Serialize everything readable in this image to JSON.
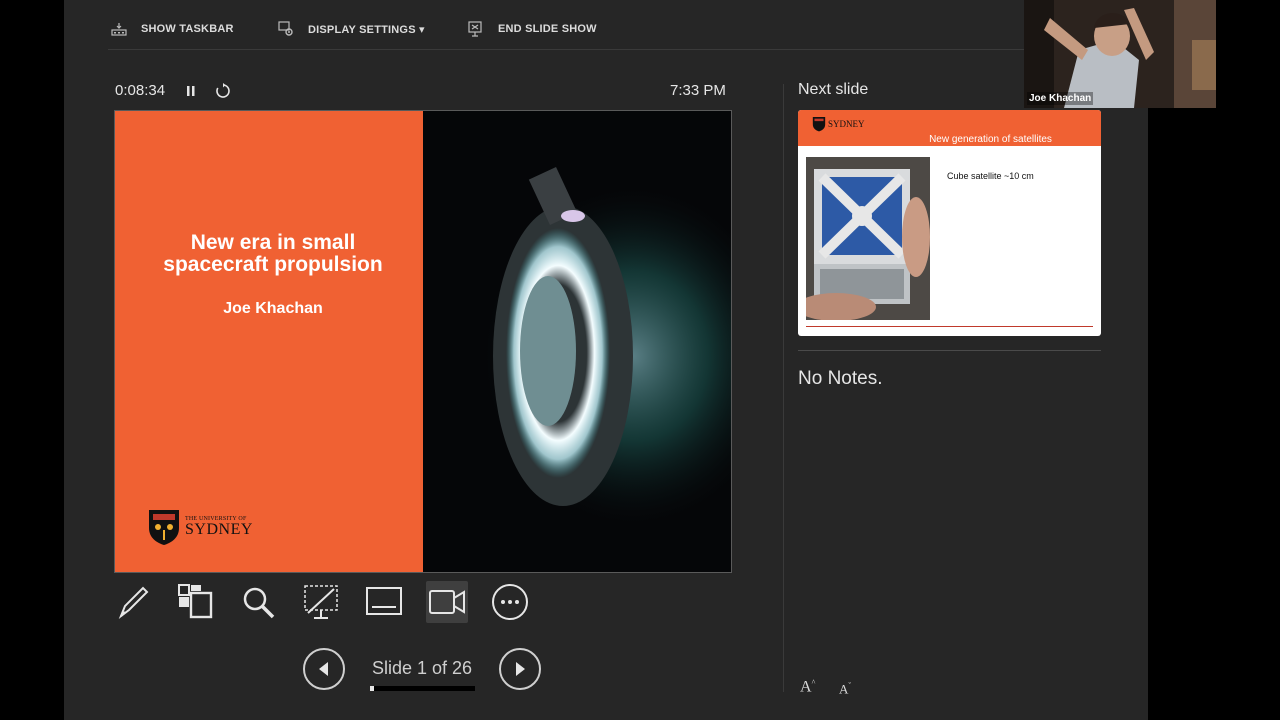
{
  "toolbar": {
    "show_taskbar": "SHOW TASKBAR",
    "display_settings": "DISPLAY SETTINGS ▾",
    "end_slide_show": "END SLIDE SHOW"
  },
  "presenter": {
    "timer": "0:08:34",
    "clock": "7:33 PM"
  },
  "current_slide": {
    "title_line1": "New era in small",
    "title_line2": "spacecraft propulsion",
    "author": "Joe Khachan",
    "logo_small": "THE UNIVERSITY OF",
    "logo_big": "SYDNEY"
  },
  "tools": [
    "pen-icon",
    "all-slides-icon",
    "zoom-icon",
    "black-screen-icon",
    "subtitles-icon",
    "camera-icon",
    "more-options-icon"
  ],
  "navigation": {
    "counter": "Slide 1 of 26",
    "current": 1,
    "total": 26
  },
  "next_slide": {
    "label": "Next slide",
    "title": "New generation of satellites",
    "body": "Cube satellite ~10 cm",
    "logo_big": "SYDNEY"
  },
  "notes": {
    "text": "No Notes."
  },
  "font_controls": {
    "increase": "A",
    "decrease": "A"
  },
  "webcam": {
    "name": "Joe Khachan"
  },
  "colors": {
    "slide_orange": "#f06133",
    "background": "#262626"
  }
}
